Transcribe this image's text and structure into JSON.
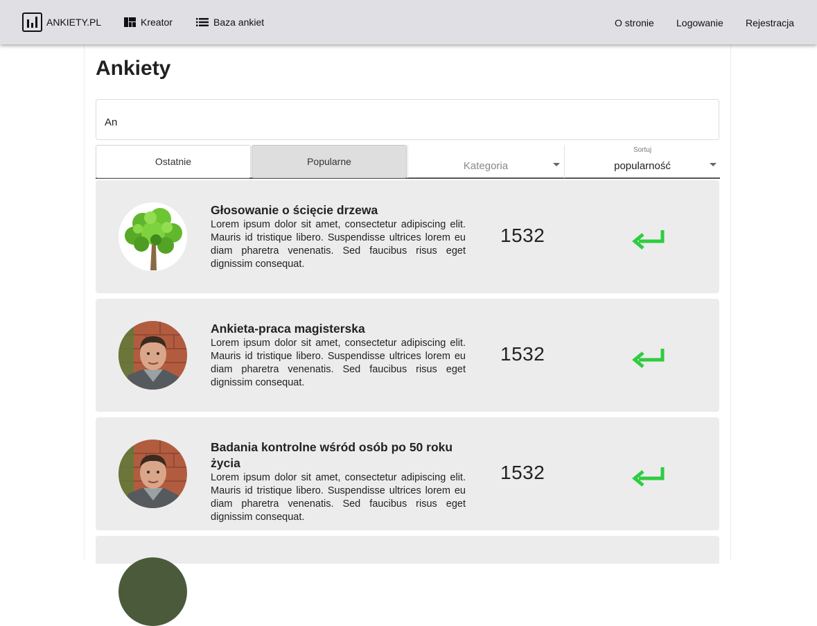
{
  "app": {
    "brand": "ANKIETY.PL",
    "nav": [
      {
        "label": "Kreator",
        "icon": "dashboard-icon"
      },
      {
        "label": "Baza ankiet",
        "icon": "list-icon"
      }
    ],
    "right_nav": [
      "O stronie",
      "Logowanie",
      "Rejestracja"
    ]
  },
  "page": {
    "title": "Ankiety",
    "search_value": "An"
  },
  "filters": {
    "tabs": [
      {
        "label": "Ostatnie",
        "active": false
      },
      {
        "label": "Popularne",
        "active": true
      }
    ],
    "category": {
      "placeholder": "Kategoria"
    },
    "sort": {
      "label": "Sortuj",
      "value": "popularność"
    }
  },
  "surveys": [
    {
      "title": "Głosowanie o ścięcie drzewa",
      "description": "Lorem ipsum dolor sit amet, consectetur adipiscing elit. Mauris id tristique libero. Suspendisse ultrices lorem eu diam pharetra venenatis. Sed faucibus risus eget dignissim consequat.",
      "count": "1532",
      "image": "tree-image",
      "action": "enter-icon"
    },
    {
      "title": "Ankieta-praca magisterska",
      "description": "Lorem ipsum dolor sit amet, consectetur adipiscing elit. Mauris id tristique libero. Suspendisse ultrices lorem eu diam pharetra venenatis. Sed faucibus risus eget dignissim consequat.",
      "count": "1532",
      "image": "person-photo",
      "action": "enter-icon"
    },
    {
      "title": "Badania kontrolne wśród osób po 50 roku życia",
      "description": "Lorem ipsum dolor sit amet, consectetur adipiscing elit. Mauris id tristique libero. Suspendisse ultrices lorem eu diam pharetra venenatis. Sed faucibus risus eget dignissim consequat.",
      "count": "1532",
      "image": "person-photo",
      "action": "enter-icon"
    }
  ],
  "colors": {
    "topbar": "#e0e0e4",
    "card_bg": "#ececec",
    "accent_green": "#2ecc40",
    "active_tab": "#dedede"
  }
}
